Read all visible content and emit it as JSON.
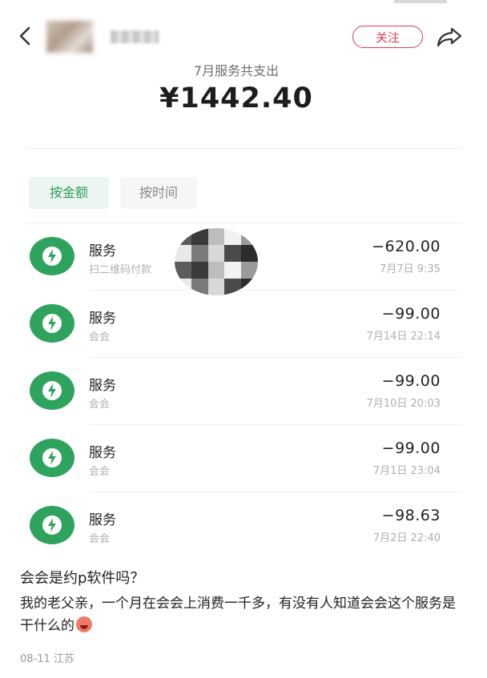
{
  "header": {
    "back_icon": "chevron-left-icon",
    "follow_label": "关注",
    "share_icon": "share-arrow-icon",
    "accent_color": "#e23b56"
  },
  "summary": {
    "label": "7月服务共支出",
    "amount": "¥1442.40"
  },
  "sort_tabs": [
    {
      "label": "按金额",
      "active": true
    },
    {
      "label": "按时间",
      "active": false
    }
  ],
  "transactions": [
    {
      "title": "服务",
      "subtitle": "扫二维码付款",
      "amount": "−620.00",
      "time": "7月7日 9:35"
    },
    {
      "title": "服务",
      "subtitle": "会会",
      "amount": "−99.00",
      "time": "7月14日 22:14"
    },
    {
      "title": "服务",
      "subtitle": "会会",
      "amount": "−99.00",
      "time": "7月10日 20:03"
    },
    {
      "title": "服务",
      "subtitle": "会会",
      "amount": "−99.00",
      "time": "7月1日 23:04"
    },
    {
      "title": "服务",
      "subtitle": "会会",
      "amount": "−98.63",
      "time": "7月2日 22:40"
    }
  ],
  "transaction_icon": "lightning-bolt-icon",
  "transaction_icon_color": "#2ea35e",
  "post": {
    "title": "会会是约p软件吗？",
    "body": "我的老父亲，一个月在会会上消费一千多，有没有人知道会会这个服务是干什么的",
    "emoji": "crying-face-emoji",
    "meta": "08-11 江苏"
  }
}
